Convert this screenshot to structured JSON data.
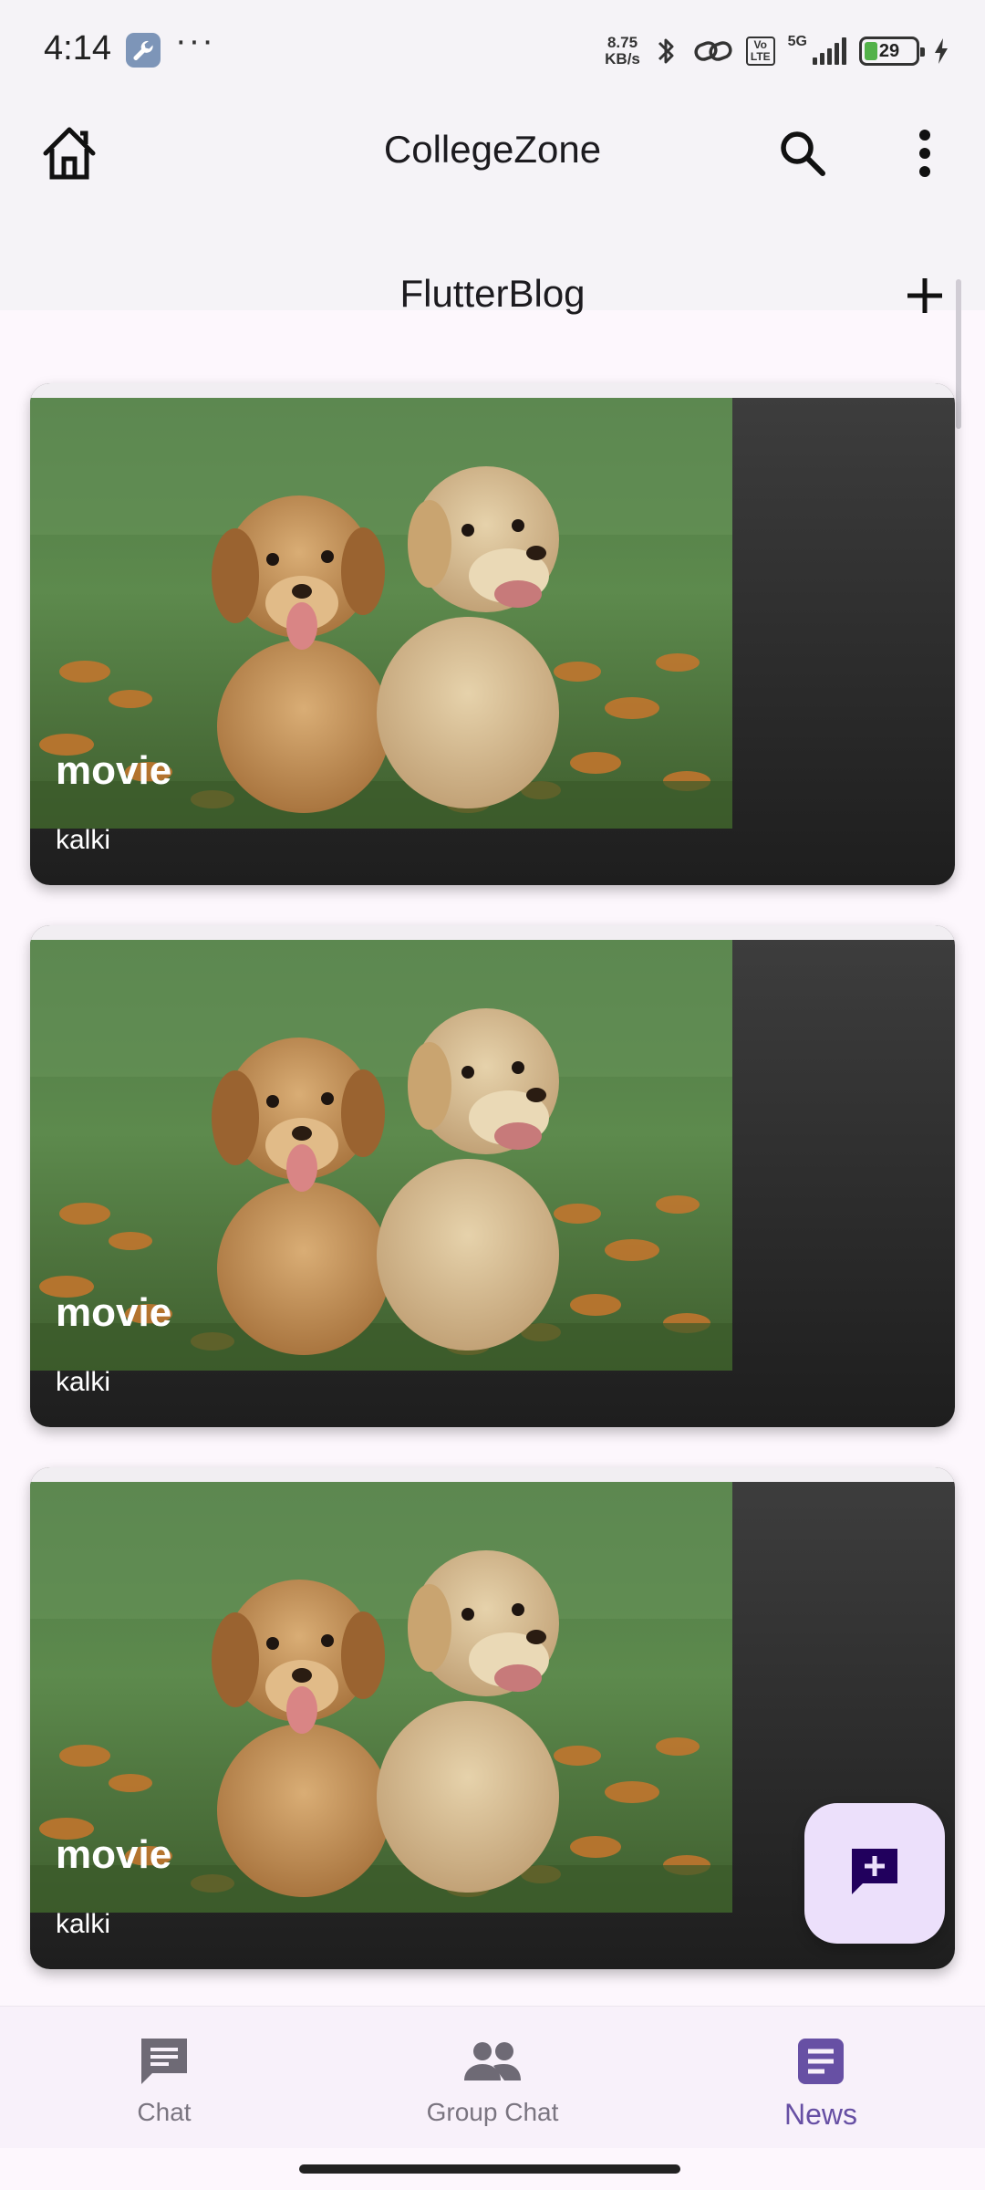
{
  "status_bar": {
    "time": "4:14",
    "net_speed_value": "8.75",
    "net_speed_unit": "KB/s",
    "volte_top": "Vo",
    "volte_bottom": "LTE",
    "network": "5G",
    "battery": "29"
  },
  "app_bar": {
    "title": "CollegeZone",
    "home_icon": "home-icon",
    "search_icon": "search-icon",
    "more_icon": "more-vert-icon"
  },
  "blog": {
    "title": "FlutterBlog",
    "add_icon": "add-icon"
  },
  "posts": [
    {
      "title": "movie",
      "subtitle": "kalki",
      "image": "two-puppies-in-flower-field"
    },
    {
      "title": "movie",
      "subtitle": "kalki",
      "image": "two-puppies-in-flower-field"
    },
    {
      "title": "movie",
      "subtitle": "kalki",
      "image": "two-puppies-in-flower-field"
    }
  ],
  "fab": {
    "icon": "add-comment-icon"
  },
  "bottom_nav": {
    "items": [
      {
        "label": "Chat",
        "icon": "chat-icon",
        "active": false
      },
      {
        "label": "Group Chat",
        "icon": "group-icon",
        "active": false
      },
      {
        "label": "News",
        "icon": "article-icon",
        "active": true
      }
    ]
  },
  "colors": {
    "accent": "#6750a4",
    "fab_bg": "#ece0fb",
    "appbar_bg": "#f5f3f7",
    "card_dark": "#1e1e1e"
  }
}
